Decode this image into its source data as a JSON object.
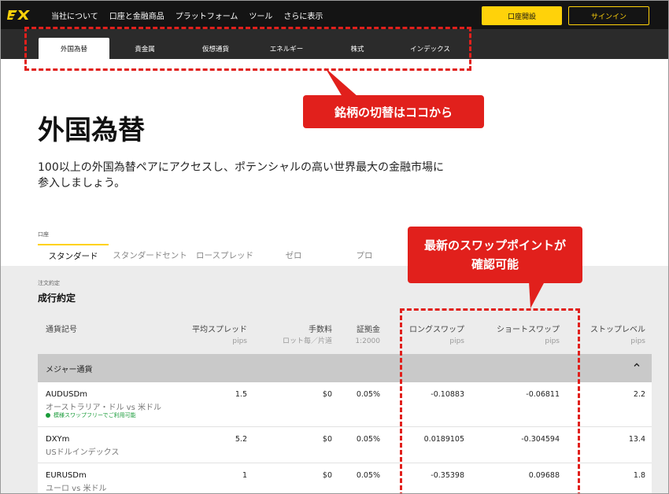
{
  "topnav": {
    "items": [
      "当社について",
      "口座と金融商品",
      "プラットフォーム",
      "ツール",
      "さらに表示"
    ],
    "open_account": "口座開設",
    "sign_in": "サインイン"
  },
  "instrument_tabs": [
    "外国為替",
    "貴金属",
    "仮想通貨",
    "エネルギー",
    "株式",
    "インデックス"
  ],
  "annotations": {
    "callout1": "銘柄の切替はココから",
    "callout2_line1": "最新のスワップポイントが",
    "callout2_line2": "確認可能"
  },
  "page": {
    "title": "外国為替",
    "description": "100以上の外国為替ペアにアクセスし、ポテンシャルの高い世界最大の金融市場に参入しましょう。"
  },
  "account": {
    "label": "口座",
    "tabs": [
      "スタンダード",
      "スタンダードセント",
      "ロースプレッド",
      "ゼロ",
      "プロ"
    ]
  },
  "execution": {
    "label": "注文約定",
    "title": "成行約定"
  },
  "table": {
    "headers": {
      "symbol": "通貨記号",
      "spread": "平均スプレッド",
      "spread_unit": "pips",
      "commission": "手数料",
      "commission_unit": "ロット毎／片道",
      "margin": "証拠金",
      "margin_unit": "1:2000",
      "long_swap": "ロングスワップ",
      "long_swap_unit": "pips",
      "short_swap": "ショートスワップ",
      "short_swap_unit": "pips",
      "stop_level": "ストップレベル",
      "stop_level_unit": "pips"
    },
    "section": "メジャー通貨",
    "rows": [
      {
        "symbol": "AUDUSDm",
        "name": "オーストラリア・ドル vs 米ドル",
        "swap_free": "模様スワップフリーでご利用可能",
        "spread": "1.5",
        "commission": "$0",
        "margin": "0.05%",
        "long_swap": "-0.10883",
        "short_swap": "-0.06811",
        "stop_level": "2.2"
      },
      {
        "symbol": "DXYm",
        "name": "USドルインデックス",
        "spread": "5.2",
        "commission": "$0",
        "margin": "0.05%",
        "long_swap": "0.0189105",
        "short_swap": "-0.304594",
        "stop_level": "13.4"
      },
      {
        "symbol": "EURUSDm",
        "name": "ユーロ vs 米ドル",
        "spread": "1",
        "commission": "$0",
        "margin": "0.05%",
        "long_swap": "-0.35398",
        "short_swap": "0.09688",
        "stop_level": "1.8"
      }
    ]
  },
  "colors": {
    "brand_yellow": "#ffd20a",
    "annotation_red": "#e1201c",
    "topbar": "#141414",
    "tabbar": "#2b2b2b"
  }
}
